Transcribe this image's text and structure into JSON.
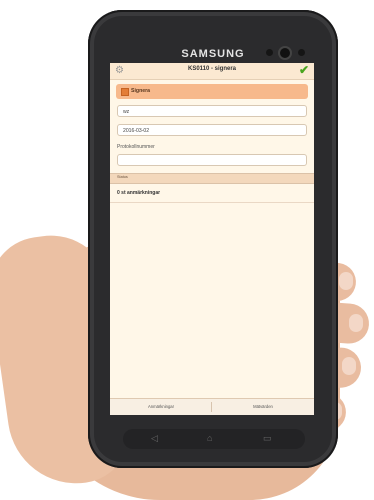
{
  "device": {
    "brand": "SAMSUNG"
  },
  "app": {
    "title": "KS0110 - signera",
    "sign_label": "Signera",
    "field_initials": "wz",
    "field_date": "2016-03-02",
    "protocol_label": "Protokollnummer",
    "status_label": "Status",
    "remarks": "0 st anmärkningar",
    "tabs": [
      "Anmärkningar",
      "Mätvärden"
    ]
  },
  "icons": {
    "settings": "gear-icon",
    "confirm": "checkmark-icon",
    "back": "back-icon",
    "home": "home-icon",
    "recent": "recent-apps-icon"
  },
  "colors": {
    "accent": "#f7b98c",
    "confirm": "#4aa51f",
    "screen_bg": "#fff7e8"
  }
}
